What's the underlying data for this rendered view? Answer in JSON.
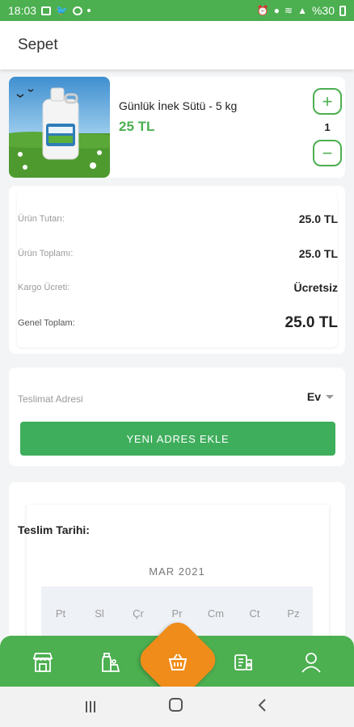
{
  "status_bar": {
    "time": "18:03",
    "battery": "%30"
  },
  "header": {
    "title": "Sepet"
  },
  "product": {
    "name": "Günlük İnek Sütü - 5 kg",
    "price": "25 TL",
    "quantity": "1",
    "plus_label": "+",
    "minus_label": "−"
  },
  "summary": {
    "rows": [
      {
        "label": "Ürün Tutarı:",
        "value": "25.0 TL"
      },
      {
        "label": "Ürün Toplamı:",
        "value": "25.0 TL"
      },
      {
        "label": "Kargo Ücreti:",
        "value": "Ücretsiz"
      },
      {
        "label": "Genel Toplam:",
        "value": "25.0 TL"
      }
    ]
  },
  "address": {
    "label": "Teslimat Adresi",
    "selected": "Ev",
    "add_button": "YENI ADRES EKLE"
  },
  "delivery": {
    "label": "Teslim Tarihi:",
    "month": "MAR 2021",
    "weekdays": [
      "Pt",
      "Sl",
      "Çr",
      "Pr",
      "Cm",
      "Ct",
      "Pz"
    ]
  },
  "colors": {
    "primary_green": "#4caf50",
    "accent_orange": "#f08c1a"
  },
  "icons": {
    "nav": [
      "store-icon",
      "farm-products-icon",
      "basket-icon",
      "coupon-icon",
      "profile-icon"
    ]
  }
}
